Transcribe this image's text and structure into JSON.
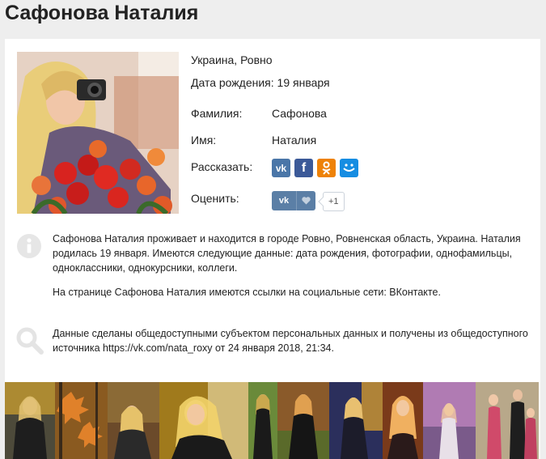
{
  "page": {
    "title": "Сафонова Наталия"
  },
  "profile": {
    "location": "Украина, Ровно",
    "birthday": "Дата рождения: 19 января",
    "surname_label": "Фамилия:",
    "surname_value": "Сафонова",
    "name_label": "Имя:",
    "name_value": "Наталия",
    "share_label": "Рассказать:",
    "rate_label": "Оценить:",
    "like_count": "+1",
    "share_buttons": [
      {
        "icon": "vk-icon",
        "text": "vk",
        "color": "#4a76a8"
      },
      {
        "icon": "facebook-icon",
        "text": "f",
        "color": "#3b5998"
      },
      {
        "icon": "odnoklassniki-icon",
        "text": "ok",
        "color": "#ee8208"
      },
      {
        "icon": "moimir-icon",
        "text": "mm",
        "color": "#168de2"
      }
    ],
    "like_button": {
      "icon": "vk-icon",
      "text": "vk",
      "heart_icon": "heart-icon",
      "color": "#5b7fa6"
    }
  },
  "description": {
    "paragraph1": "Сафонова Наталия проживает и находится в городе Ровно, Ровненская область, Украина. Наталия родилась 19 января. Имеются следующие данные: дата рождения, фотографии, однофамильцы, одноклассники, однокурсники, коллеги.",
    "paragraph2": "На странице Сафонова Наталия имеются ссылки на социальные сети: ВКонтакте.",
    "source": "Данные сделаны общедоступными субъектом персональных данных и получены из общедоступного источника https://vk.com/nata_roxy от 24 января 2018, 21:34."
  },
  "icons": {
    "info": "info-icon",
    "search": "search-icon"
  },
  "gallery": [
    {
      "bg": "#4d4a3a",
      "accent": "#d4a52f"
    },
    {
      "bg": "#8a5a20",
      "accent": "#e0812a"
    },
    {
      "bg": "#6b4a2a",
      "accent": "#e6c26a"
    },
    {
      "bg": "#a07a1c",
      "accent": "#f2d36a"
    },
    {
      "bg": "#6a8a3a",
      "accent": "#caa84e"
    },
    {
      "bg": "#8a5a2a",
      "accent": "#e0a050"
    },
    {
      "bg": "#2b2f5c",
      "accent": "#e8a62a"
    },
    {
      "bg": "#7a3a1a",
      "accent": "#f0b060"
    },
    {
      "bg": "#b07bb3",
      "accent": "#f0c8a0"
    },
    {
      "bg": "#b8a88a",
      "accent": "#d04a6a"
    }
  ]
}
